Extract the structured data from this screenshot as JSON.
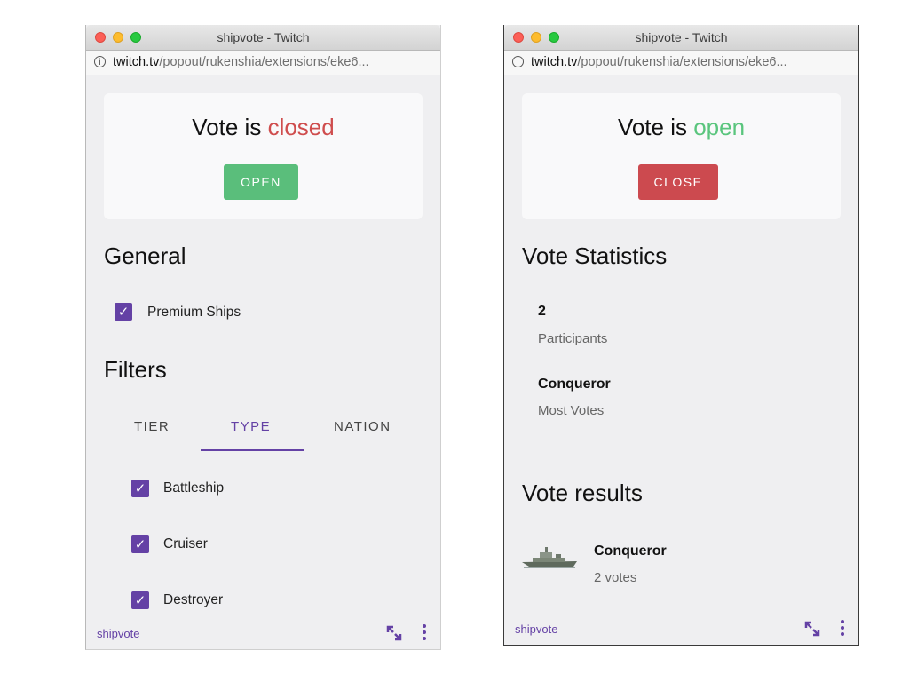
{
  "windows": [
    {
      "title": "shipvote - Twitch",
      "url_host": "twitch.tv",
      "url_path": "/popout/rukenshia/extensions/eke6...",
      "vote_prefix": "Vote is ",
      "vote_status": "closed",
      "action_label": "OPEN",
      "general_heading": "General",
      "general_option": "Premium Ships",
      "filters_heading": "Filters",
      "tabs": [
        "TIER",
        "TYPE",
        "NATION"
      ],
      "active_tab": "TYPE",
      "filter_items": [
        "Battleship",
        "Cruiser",
        "Destroyer"
      ],
      "footer_brand": "shipvote"
    },
    {
      "title": "shipvote - Twitch",
      "url_host": "twitch.tv",
      "url_path": "/popout/rukenshia/extensions/eke6...",
      "vote_prefix": "Vote is ",
      "vote_status": "open",
      "action_label": "CLOSE",
      "stats_heading": "Vote Statistics",
      "stats": [
        {
          "value": "2",
          "label": "Participants"
        },
        {
          "value": "Conqueror",
          "label": "Most Votes"
        }
      ],
      "results_heading": "Vote results",
      "results": [
        {
          "ship": "Conqueror",
          "votes": "2 votes"
        }
      ],
      "footer_brand": "shipvote"
    }
  ],
  "colors": {
    "accent": "#6441a5",
    "closed": "#cf4d4d",
    "open": "#5ac57d",
    "open_button": "#5abe7b",
    "close_button": "#cc4a4f"
  },
  "icons": [
    "info-icon",
    "checkmark-icon",
    "picture-in-picture-icon",
    "more-vertical-icon",
    "ship-thumbnail"
  ]
}
